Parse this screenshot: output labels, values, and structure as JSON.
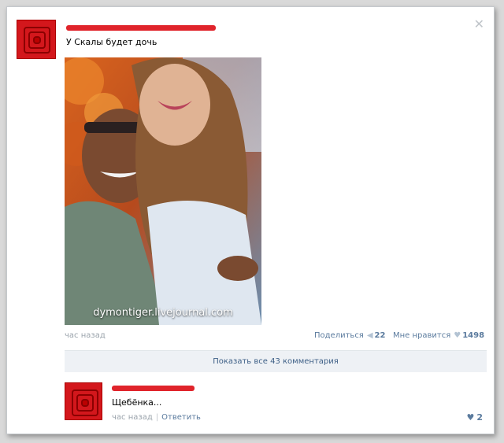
{
  "post": {
    "text": "У Скалы будет дочь",
    "close_glyph": "✕",
    "photo_watermark": "dymontiger.livejournal.com",
    "time": "час назад",
    "share_label": "Поделиться",
    "share_count": "22",
    "like_label": "Мне нравится",
    "like_count": "1498"
  },
  "show_all_comments": "Показать все 43 комментария",
  "comment": {
    "text": "Щебёнка...",
    "time": "час назад",
    "separator": "|",
    "reply_label": "Ответить",
    "like_count": "2"
  },
  "colors": {
    "avatar_red": "#d3171c",
    "redaction_red": "#e0242b",
    "link_blue": "#5b7b9e"
  },
  "icons": {
    "share": "megaphone-icon",
    "like": "heart-icon",
    "close": "close-icon"
  }
}
